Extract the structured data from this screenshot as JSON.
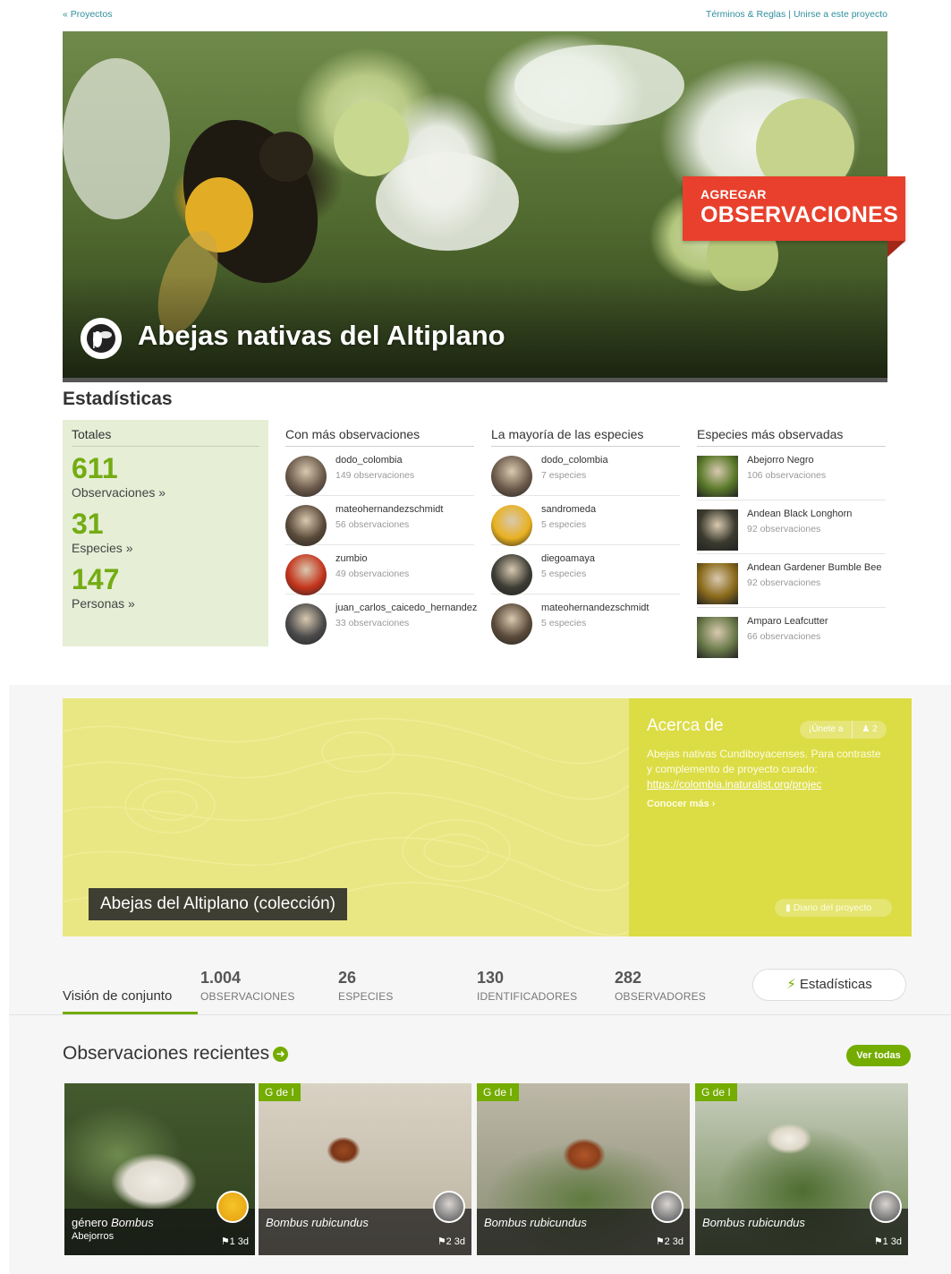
{
  "nav": {
    "back_link": "« Proyectos",
    "terms_link": "Términos & Reglas",
    "separator": "|",
    "join_link": "Unirse a este proyecto"
  },
  "hero": {
    "title": "Abejas nativas del Altiplano",
    "add_line1": "AGREGAR",
    "add_line2": "OBSERVACIONES"
  },
  "stats": {
    "heading": "Estadísticas",
    "totals": {
      "heading": "Totales",
      "items": [
        {
          "value": "611",
          "label": "Observaciones »"
        },
        {
          "value": "31",
          "label": "Especies »"
        },
        {
          "value": "147",
          "label": "Personas »"
        }
      ]
    },
    "top_observers": {
      "heading": "Con más observaciones",
      "items": [
        {
          "name": "dodo_colombia",
          "sub": "149 observaciones",
          "color": "#6b5a4a"
        },
        {
          "name": "mateohernandezschmidt",
          "sub": "56 observaciones",
          "color": "#5a4a3a"
        },
        {
          "name": "zumbio",
          "sub": "49 observaciones",
          "color": "#c4341c"
        },
        {
          "name": "juan_carlos_caicedo_hernandez",
          "sub": "33 observaciones",
          "color": "#4a4a4a"
        }
      ]
    },
    "top_species_people": {
      "heading": "La mayoría de las especies",
      "items": [
        {
          "name": "dodo_colombia",
          "sub": "7 especies",
          "color": "#6b5a4a"
        },
        {
          "name": "sandromeda",
          "sub": "5 especies",
          "color": "#e8b020"
        },
        {
          "name": "diegoamaya",
          "sub": "5 especies",
          "color": "#3c3c34"
        },
        {
          "name": "mateohernandezschmidt",
          "sub": "5 especies",
          "color": "#5a4a3a"
        }
      ]
    },
    "top_species": {
      "heading": "Especies más observadas",
      "items": [
        {
          "name": "Abejorro Negro",
          "sub": "106 observaciones",
          "color": "#5a7a2a"
        },
        {
          "name": "Andean Black Longhorn",
          "sub": "92 observaciones",
          "color": "#3a3a2e"
        },
        {
          "name": "Andean Gardener Bumble Bee",
          "sub": "92 observaciones",
          "color": "#8a6a1a"
        },
        {
          "name": "Amparo Leafcutter",
          "sub": "66 observaciones",
          "color": "#6a7a4a"
        }
      ]
    }
  },
  "project2": {
    "banner_title": "Abejas del Altiplano (colección)",
    "about": {
      "heading": "Acerca de",
      "join_label": "¡Únete a",
      "member_count": "2",
      "text_line": "Abejas nativas Cundiboyacenses. Para contraste y complemento de proyecto curado: ",
      "url_text": "https://colombia.inaturalist.org/projec",
      "more_label": "Conocer más ›",
      "journal_label": "Diario del proyecto"
    },
    "tabs": {
      "overview_label": "Visión de conjunto",
      "stats": [
        {
          "value": "1.004",
          "label": "OBSERVACIONES"
        },
        {
          "value": "26",
          "label": "ESPECIES"
        },
        {
          "value": "130",
          "label": "IDENTIFICADORES"
        },
        {
          "value": "282",
          "label": "OBSERVADORES"
        }
      ],
      "stats_button": "Estadísticas"
    },
    "recent": {
      "heading": "Observaciones recientes",
      "view_all": "Ver todas",
      "items": [
        {
          "badge": "",
          "prefix": "género ",
          "taxon": "Bombus",
          "common": "Abejorros",
          "ids": "1",
          "age": "3d"
        },
        {
          "badge": "G de I",
          "prefix": "",
          "taxon": "Bombus rubicundus",
          "common": "",
          "ids": "2",
          "age": "3d"
        },
        {
          "badge": "G de I",
          "prefix": "",
          "taxon": "Bombus rubicundus",
          "common": "",
          "ids": "2",
          "age": "3d"
        },
        {
          "badge": "G de I",
          "prefix": "",
          "taxon": "Bombus rubicundus",
          "common": "",
          "ids": "1",
          "age": "3d"
        }
      ]
    }
  },
  "colors": {
    "accent_green": "#74ac00",
    "add_red": "#e8402c",
    "link_teal": "#2f8f9d",
    "about_yellow": "#dcdc45"
  }
}
